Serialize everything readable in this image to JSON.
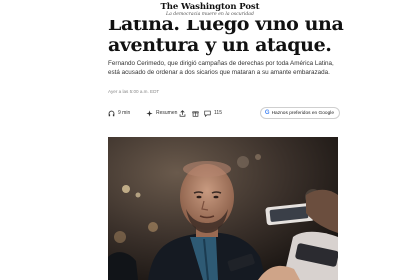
{
  "masthead": {
    "logo": "The Washington Post",
    "tagline": "La democracia muere en la oscuridad"
  },
  "article": {
    "headline_line1": "Latina. Luego vino una",
    "headline_line2": "aventura y un ataque.",
    "dek": "Fernando Cerimedo, que dirigió campañas de derechas por toda América Latina, está acusado de ordenar a dos sicarios que mataran a su amante embarazada.",
    "timestamp": "Ayer a las 5:00 a.m. EDT"
  },
  "toolbar": {
    "read_time": "9 min",
    "summary_label": "Resumen",
    "comments_count": "115",
    "preferred_label": "Haznos preferidos en Google",
    "google_letter": "G"
  },
  "colors": {
    "text": "#111111",
    "dek": "#333333",
    "timestamp": "#888888",
    "google_blue": "#4285f4"
  }
}
